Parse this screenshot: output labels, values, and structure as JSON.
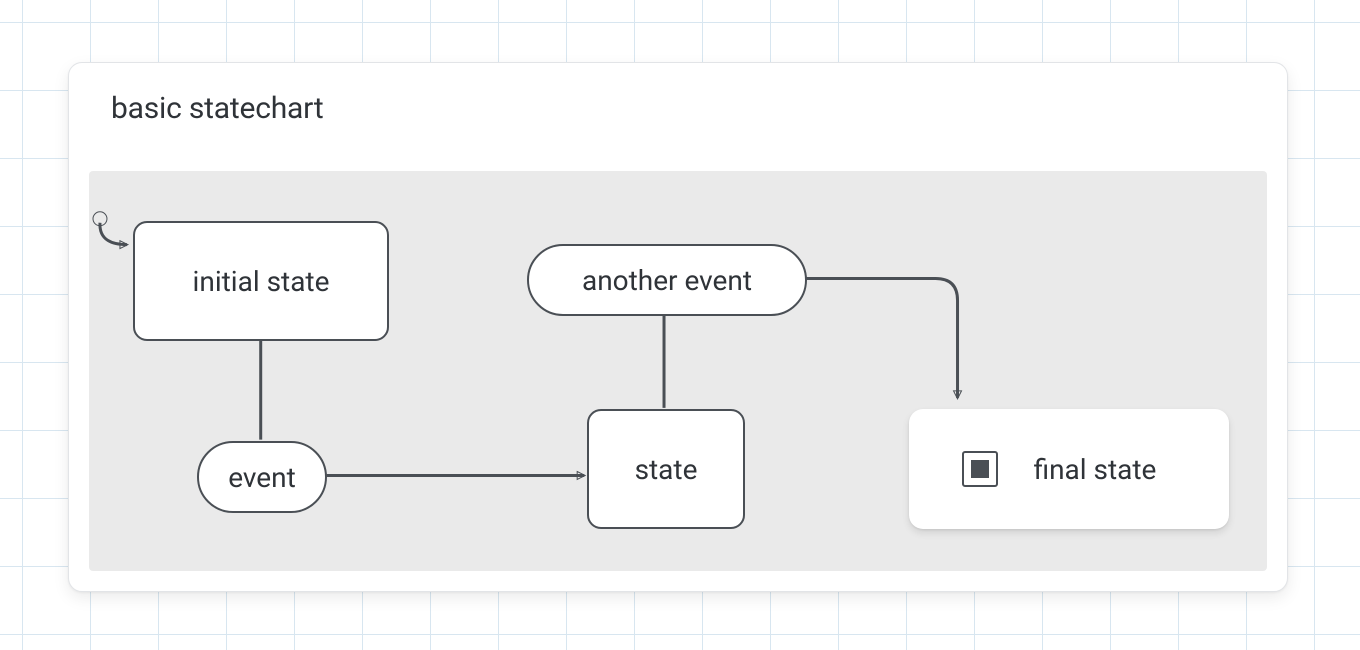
{
  "chart": {
    "title": "basic statechart"
  },
  "states": {
    "initial": "initial state",
    "state": "state",
    "final": "final state"
  },
  "events": {
    "event": "event",
    "another": "another event"
  },
  "chart_data": {
    "type": "statechart",
    "title": "basic statechart",
    "initial": "initial state",
    "states": [
      {
        "id": "initial state",
        "type": "state",
        "initial": true
      },
      {
        "id": "state",
        "type": "state"
      },
      {
        "id": "final state",
        "type": "final"
      }
    ],
    "transitions": [
      {
        "from": "initial state",
        "event": "event",
        "to": "state"
      },
      {
        "from": "state",
        "event": "another event",
        "to": "final state"
      }
    ]
  }
}
